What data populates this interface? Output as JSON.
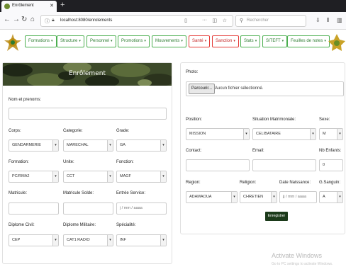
{
  "browser": {
    "tab_title": "Enrôlement",
    "url": "localhost:8080/enrolements",
    "search_placeholder": "Rechercher"
  },
  "menu": {
    "items": [
      {
        "label": "Formations",
        "style": "green"
      },
      {
        "label": "Structure",
        "style": "green"
      },
      {
        "label": "Personnel",
        "style": "green"
      },
      {
        "label": "Promotions",
        "style": "green"
      },
      {
        "label": "Mouvements",
        "style": "green"
      },
      {
        "label": "Santé",
        "style": "red"
      },
      {
        "label": "Sanction",
        "style": "red"
      },
      {
        "label": "Stats",
        "style": "green"
      },
      {
        "label": "SITEFT",
        "style": "green"
      },
      {
        "label": "Feuilles de notes",
        "style": "green"
      }
    ]
  },
  "form_left": {
    "title": "Enrôlement",
    "nom_label": "Nom et prenoms:",
    "corps_label": "Corps:",
    "corps_value": "GENDARMERIE",
    "categorie_label": "Categorie:",
    "categorie_value": "MARECHAL",
    "grade_label": "Grade:",
    "grade_value": "GA",
    "formation_label": "Formation:",
    "formation_value": "PC/RMA2",
    "unite_label": "Unite:",
    "unite_value": "CCT",
    "fonction_label": "Fonction:",
    "fonction_value": "MAGF",
    "matricule_label": "Matricule:",
    "matricule_solde_label": "Matricule Solde:",
    "entree_service_label": "Entrée Service:",
    "entree_service_placeholder": "j / mm / aaaa",
    "diplome_civil_label": "Diplome Civil:",
    "diplome_civil_value": "CEP",
    "diplome_militaire_label": "Diplome Militaire:",
    "diplome_militaire_value": "CAT1 RADIO",
    "specialite_label": "Spécialité:",
    "specialite_value": "INF"
  },
  "form_right": {
    "photo_label": "Photo:",
    "file_button": "Parcourir...",
    "file_status": "Aucun fichier sélectionné.",
    "position_label": "Position:",
    "position_value": "MISSION",
    "situation_label": "Situation Matrimoniale:",
    "situation_value": "CELIBATAIRE",
    "sexe_label": "Sexe:",
    "sexe_value": "M",
    "contact_label": "Contact:",
    "email_label": "Email:",
    "nb_enfants_label": "Nb Enfants:",
    "nb_enfants_value": "0",
    "region_label": "Region:",
    "region_value": "ADAMAOUA",
    "religion_label": "Religion:",
    "religion_value": "CHRETIEN",
    "date_naissance_label": "Date Naissance:",
    "date_naissance_placeholder": "jj / mm / aaaa",
    "groupe_sanguin_label": "G.Sanguin:",
    "groupe_sanguin_value": "A",
    "submit_label": "Enregistrer"
  },
  "watermark": {
    "line1": "Activate Windows",
    "line2": "Go to PC settings to activate Windows."
  }
}
